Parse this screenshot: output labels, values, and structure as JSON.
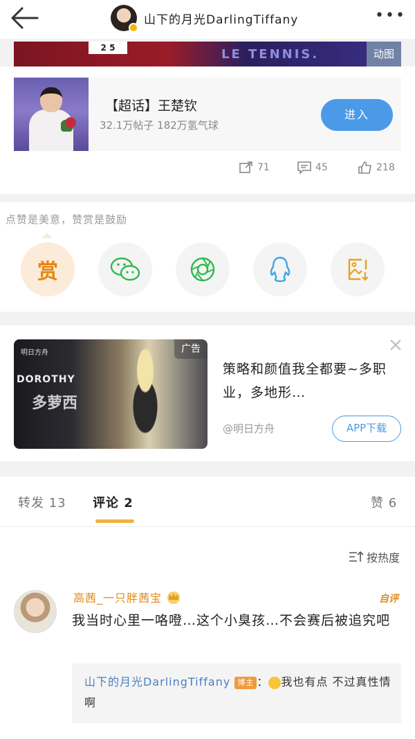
{
  "header": {
    "title": "山下的月光DarlingTiffany",
    "more_label": "•••"
  },
  "banner": {
    "score": "2 5",
    "text": "LE TENNIS.",
    "gif_label": "动图"
  },
  "topic": {
    "title": "【超话】王楚钦",
    "subtitle": "32.1万帖子  182万氢气球",
    "enter_label": "进入"
  },
  "actions": {
    "repost_count": "71",
    "comment_count": "45",
    "like_count": "218"
  },
  "reward": {
    "hint": "点赞是美意，赞赏是鼓励",
    "reward_label": "赏"
  },
  "ad": {
    "tag": "广告",
    "logo": "明日方舟",
    "brand": "DOROTHY",
    "brand_cn": "多萝西",
    "text": "策略和颜值我全都要~多职业，多地形…",
    "source": "@明日方舟",
    "download_label": "APP下载"
  },
  "tabs": {
    "repost": "转发 13",
    "comment": "评论 2",
    "like": "赞 6"
  },
  "sort_label": "按热度",
  "comment": {
    "author": "高茜_一只胖茜宝",
    "self_label": "自评",
    "text": "我当时心里一咯噔…这个小臭孩…不会赛后被追究吧",
    "reply": {
      "user": "山下的月光DarlingTiffany",
      "owner_badge": "博主",
      "colon": "：",
      "text": "我也有点 不过真性情啊"
    }
  },
  "colors": {
    "accent_blue": "#4a9ae8",
    "accent_orange": "#e08b1a",
    "wechat_green": "#2fba4b",
    "qq_blue": "#3aa6e8"
  }
}
